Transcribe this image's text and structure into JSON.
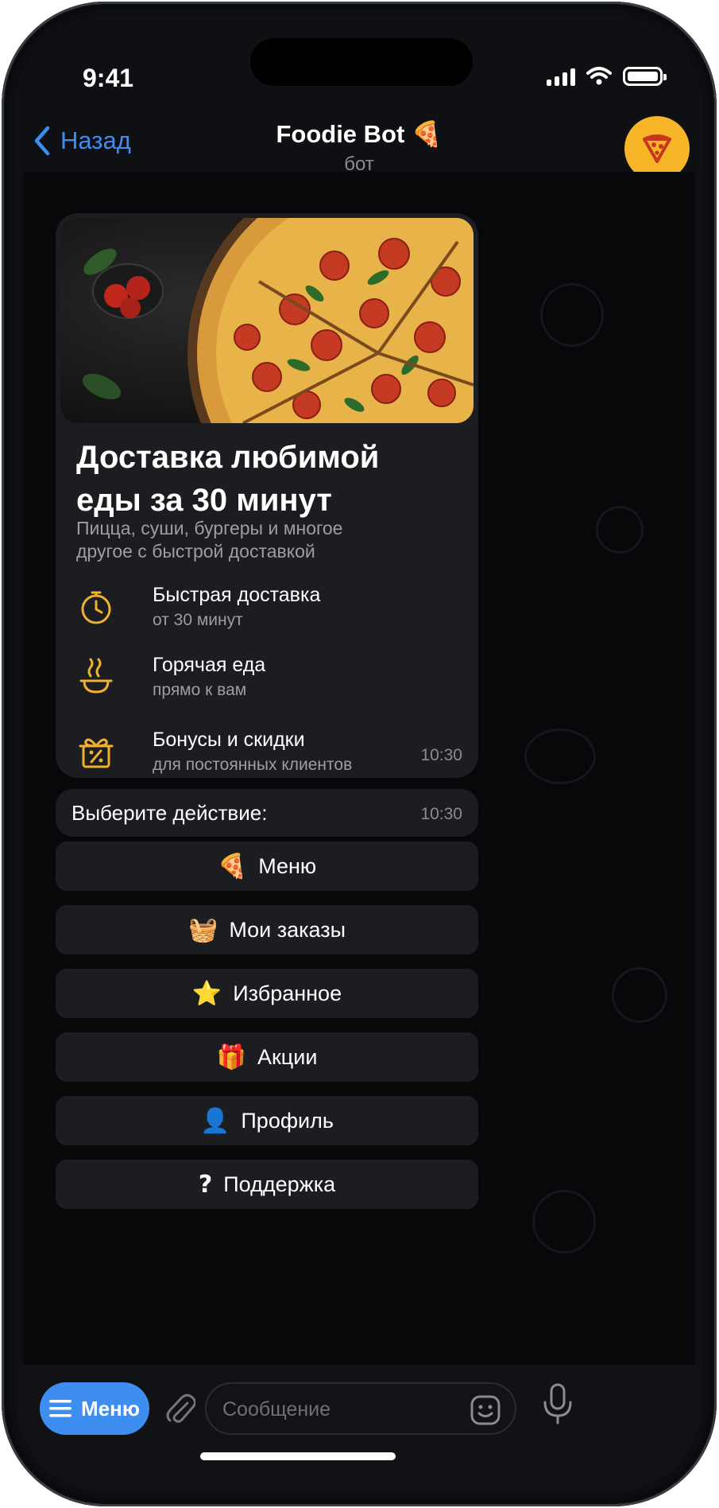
{
  "status_bar": {
    "time": "9:41"
  },
  "header": {
    "back_label": "Назад",
    "title": "Foodie Bot 🍕",
    "subtitle": "бот",
    "avatar_icon": "pizza-icon",
    "accent_color": "#f6b628"
  },
  "promo_card": {
    "image": "pizza-photo",
    "title_line1": "Доставка любимой",
    "title_line2": "еды за 30 минут",
    "description_line1": "Пицца, суши, бургеры и многое",
    "description_line2": "другое с быстрой доставкой",
    "features": [
      {
        "icon": "stopwatch-icon",
        "title": "Быстрая доставка",
        "subtitle": "от 30 минут"
      },
      {
        "icon": "hot-food-icon",
        "title": "Горячая еда",
        "subtitle": "прямо к вам"
      },
      {
        "icon": "gift-discount-icon",
        "title": "Бонусы и скидки",
        "subtitle": "для постоянных клиентов"
      }
    ],
    "time": "10:30"
  },
  "prompt": {
    "text": "Выберите действие:",
    "time": "10:30"
  },
  "keyboard": [
    {
      "emoji": "🍕",
      "label": "Меню"
    },
    {
      "emoji": "🧺",
      "label": "Мои заказы"
    },
    {
      "emoji": "⭐",
      "label": "Избранное"
    },
    {
      "emoji": "🎁",
      "label": "Акции"
    },
    {
      "emoji": "👤",
      "label": "Профиль"
    },
    {
      "emoji": "?",
      "label": "Поддержка"
    }
  ],
  "composer": {
    "menu_label": "Меню",
    "placeholder": "Сообщение",
    "accent_color": "#3d8ef0"
  }
}
